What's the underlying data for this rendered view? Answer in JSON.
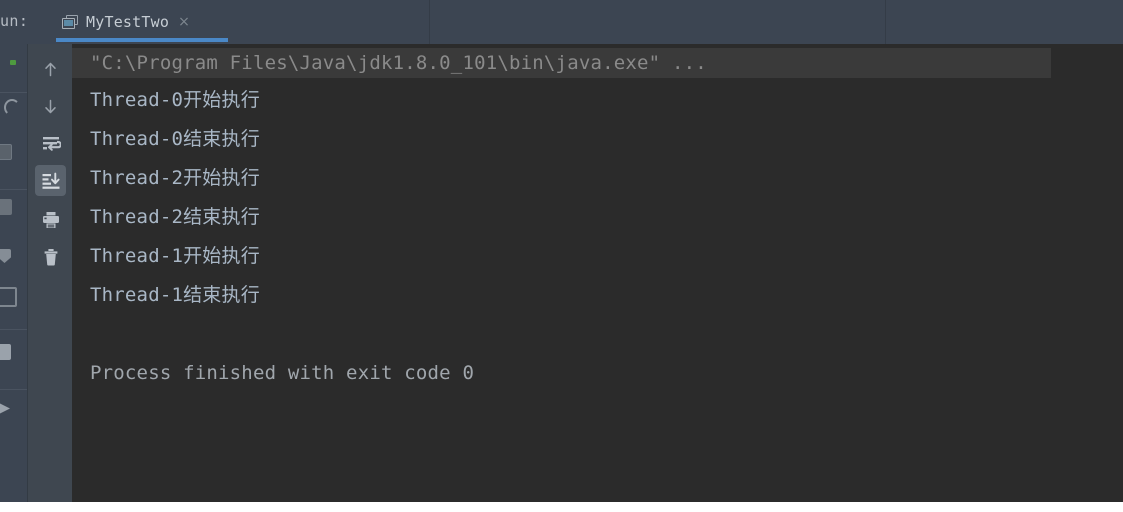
{
  "header": {
    "run_label": "un:",
    "tab": {
      "title": "MyTestTwo",
      "close_glyph": "×",
      "icon": "console-window-icon",
      "accent_color": "#4a88c7"
    },
    "background_color": "#3c4552"
  },
  "toolbar": {
    "buttons": [
      {
        "name": "up-arrow-icon",
        "label": "Up the stack trace",
        "active": false
      },
      {
        "name": "down-arrow-icon",
        "label": "Down the stack trace",
        "active": false
      },
      {
        "name": "soft-wrap-icon",
        "label": "Soft-Wrap",
        "active": false
      },
      {
        "name": "scroll-to-end-icon",
        "label": "Scroll to End",
        "active": true
      },
      {
        "name": "print-icon",
        "label": "Print",
        "active": false
      },
      {
        "name": "trash-icon",
        "label": "Clear All",
        "active": false
      }
    ]
  },
  "console": {
    "background_color": "#2b2b2b",
    "text_color": "#a9b7c6",
    "command_color": "#8a8a8a",
    "command_highlight_color": "#3a3a3a",
    "lines": [
      {
        "text": "\"C:\\Program Files\\Java\\jdk1.8.0_101\\bin\\java.exe\" ...",
        "kind": "cmd"
      },
      {
        "text": "Thread-0开始执行",
        "kind": "out"
      },
      {
        "text": "Thread-0结束执行",
        "kind": "out"
      },
      {
        "text": "Thread-2开始执行",
        "kind": "out"
      },
      {
        "text": "Thread-2结束执行",
        "kind": "out"
      },
      {
        "text": "Thread-1开始执行",
        "kind": "out"
      },
      {
        "text": "Thread-1结束执行",
        "kind": "out"
      },
      {
        "text": "",
        "kind": "out"
      },
      {
        "text": "Process finished with exit code 0",
        "kind": "sys"
      }
    ]
  }
}
